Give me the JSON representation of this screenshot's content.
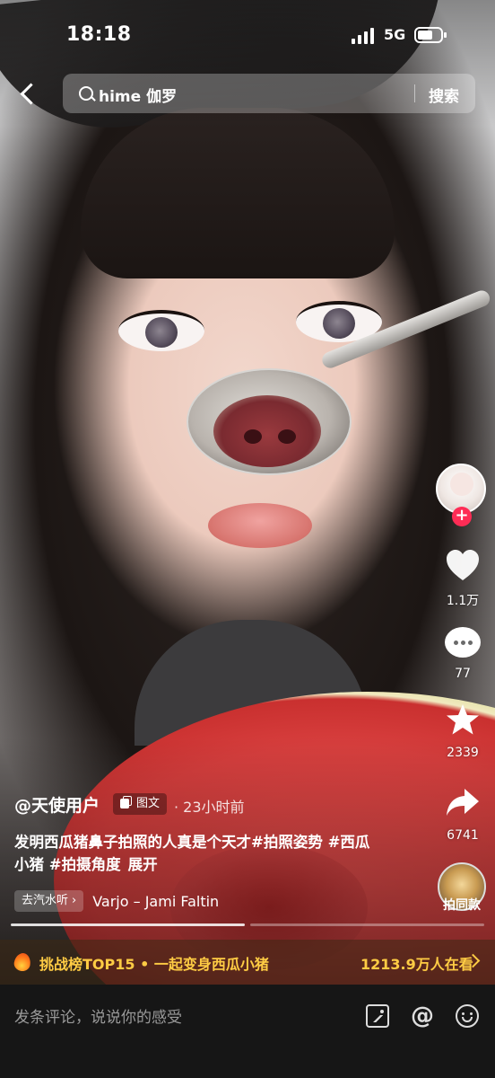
{
  "status_bar": {
    "time": "18:18",
    "network": "5G"
  },
  "search": {
    "query": "hime 伽罗",
    "button_label": "搜索"
  },
  "right_rail": {
    "follow_symbol": "+",
    "likes": "1.1万",
    "comments": "77",
    "favorites": "2339",
    "shares": "6741",
    "template_label": "拍同款"
  },
  "post": {
    "author": "@天使用户",
    "type_badge": "图文",
    "time_ago": "· 23小时前",
    "caption": "发明西瓜猪鼻子拍照的人真是个天才#拍照姿势 #西瓜小猪 #拍摄角度",
    "expand_label": "展开",
    "music_chip": "去汽水听",
    "music_title": "Varjo – Jami Faltin",
    "image_count": 2,
    "current_image": 1
  },
  "challenge": {
    "text": "挑战榜TOP15 • 一起变身西瓜小猪",
    "viewers": "1213.9万人在看"
  },
  "comment_bar": {
    "placeholder": "发条评论，说说你的感受"
  },
  "icons": [
    "back-icon",
    "search-icon",
    "heart-icon",
    "comment-icon",
    "star-icon",
    "share-icon",
    "fire-icon",
    "image-icon",
    "at-icon",
    "emoji-icon"
  ],
  "colors": {
    "follow_red": "#fe2c55",
    "challenge_gold": "#ffcc44",
    "comment_bar_bg": "#161616"
  }
}
